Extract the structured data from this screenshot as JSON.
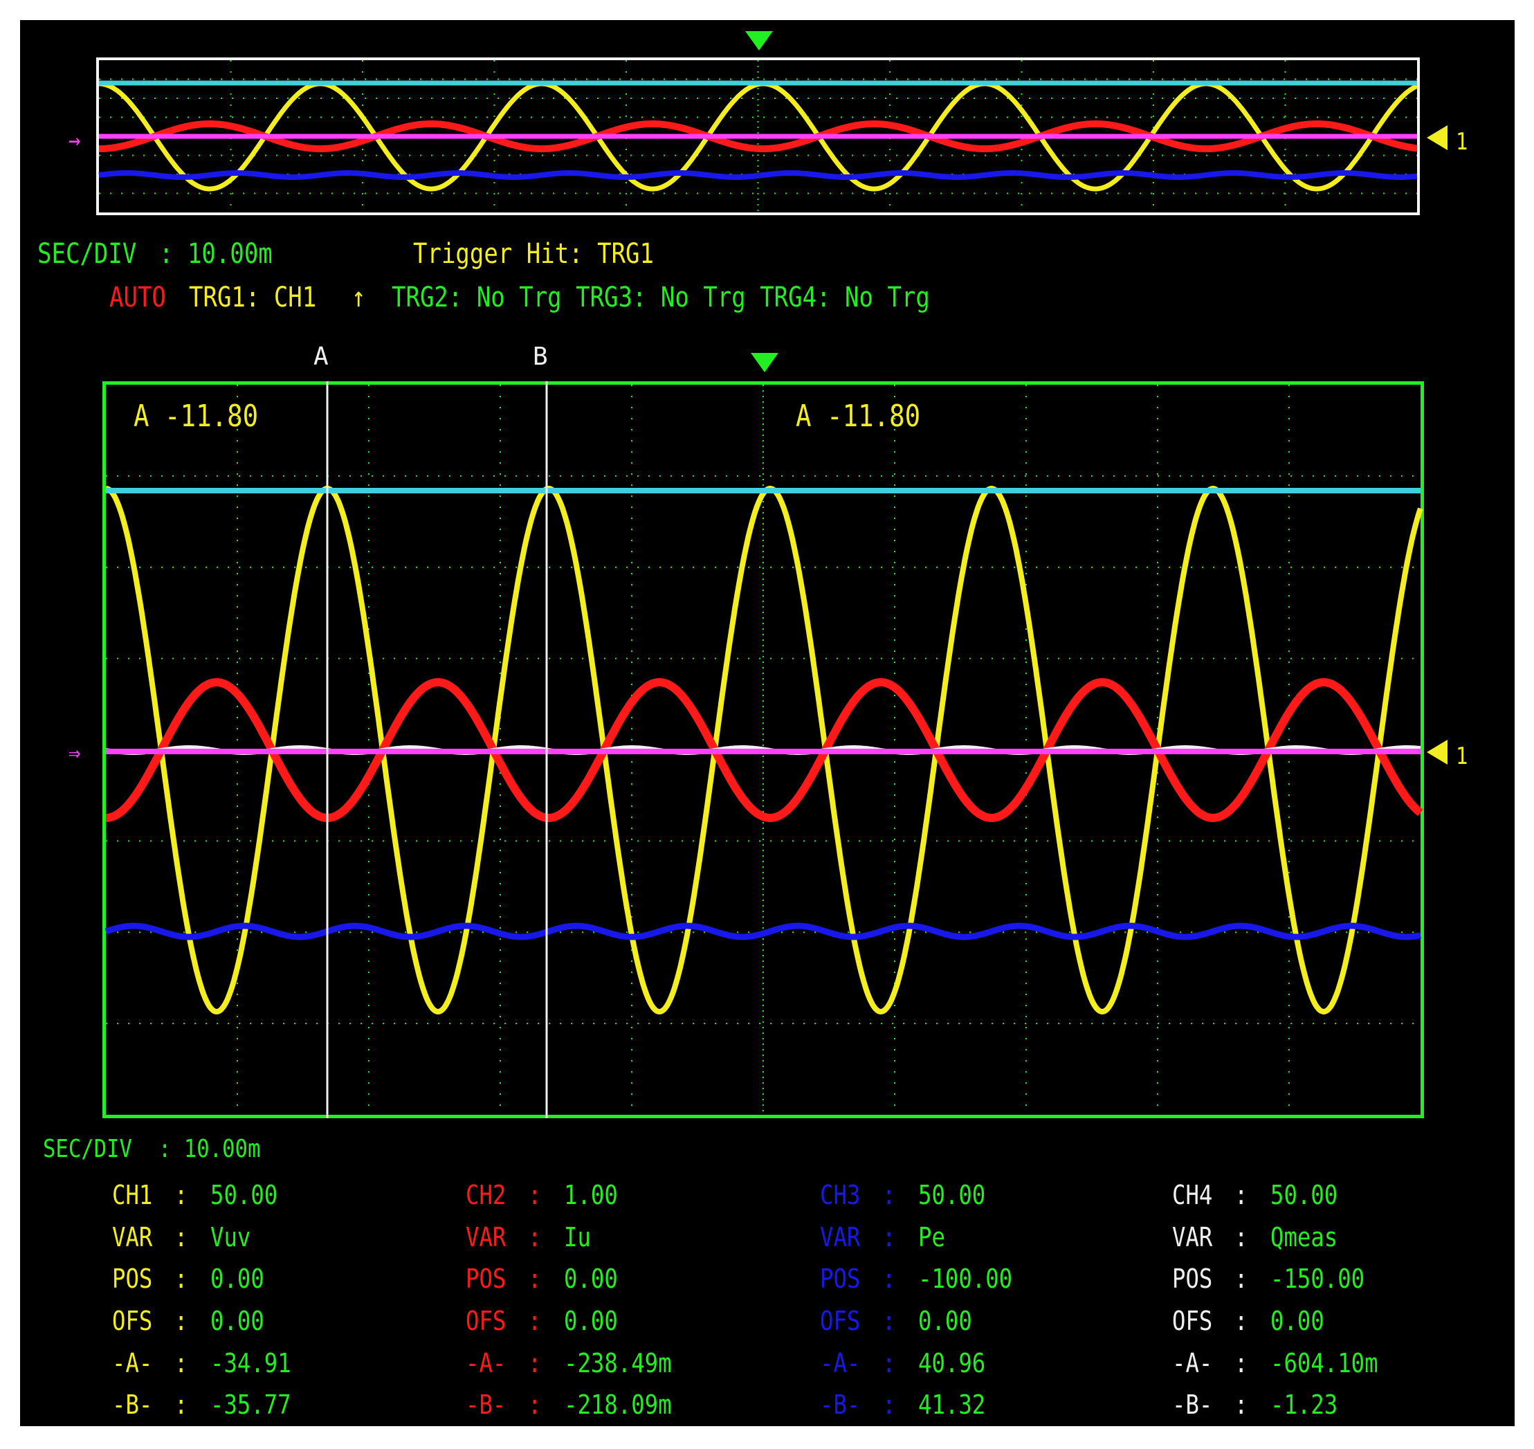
{
  "overview": {
    "sec_div_label": "SEC/DIV",
    "sec_div_value": ": 10.00m",
    "trigger_hit": "Trigger Hit: TRG1",
    "trigger_mode": "AUTO",
    "trg1": "TRG1: CH1",
    "trg1_arrow": "↑",
    "trg_rest": "TRG2: No Trg TRG3: No Trg TRG4: No Trg",
    "level_marker": "1"
  },
  "main": {
    "cursor_a_label": "A",
    "cursor_b_label": "B",
    "readout_left": "A -11.80",
    "readout_right": "A -11.80",
    "level_marker": "1"
  },
  "bottom": {
    "sec_div_label": "SEC/DIV",
    "sec_div_value": ": 10.00m"
  },
  "channels": [
    {
      "name": "CH1",
      "scale": "50.00",
      "var": "Vuv",
      "pos": "0.00",
      "ofs": "0.00",
      "a": "-34.91",
      "b": "-35.77",
      "color": "#f4ee20"
    },
    {
      "name": "CH2",
      "scale": "1.00",
      "var": "Iu",
      "pos": "0.00",
      "ofs": "0.00",
      "a": "-238.49m",
      "b": "-218.09m",
      "color": "#ff1a1a"
    },
    {
      "name": "CH3",
      "scale": "50.00",
      "var": "Pe",
      "pos": "-100.00",
      "ofs": "0.00",
      "a": "40.96",
      "b": "41.32",
      "color": "#1818e8"
    },
    {
      "name": "CH4",
      "scale": "50.00",
      "var": "Qmeas",
      "pos": "-150.00",
      "ofs": "0.00",
      "a": "-604.10m",
      "b": "-1.23",
      "color": "#f0f0f0"
    }
  ],
  "row_labels": {
    "var": "VAR",
    "pos": "POS",
    "ofs": "OFS",
    "a": "-A-",
    "b": "-B-",
    "sep": ":"
  },
  "colors": {
    "ch1": "#f4ee20",
    "ch2": "#ff1a1a",
    "ch3": "#1818e8",
    "ch4": "#f0f0f0",
    "trace_cyan": "#40d0d8",
    "trace_magenta": "#ff40ff",
    "grid": "#22ee22",
    "value": "#22ee22"
  }
}
